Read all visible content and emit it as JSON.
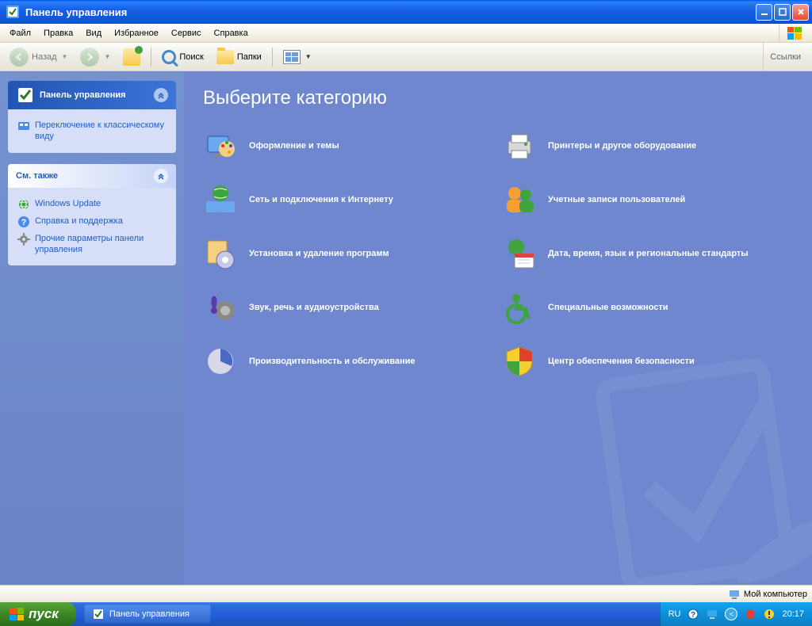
{
  "window": {
    "title": "Панель управления"
  },
  "menu": {
    "file": "Файл",
    "edit": "Правка",
    "view": "Вид",
    "favorites": "Избранное",
    "tools": "Сервис",
    "help": "Справка"
  },
  "toolbar": {
    "back": "Назад",
    "search": "Поиск",
    "folders": "Папки",
    "links": "Ссылки"
  },
  "sidebar": {
    "panel1": {
      "title": "Панель управления",
      "switch_view": "Переключение к классическому виду"
    },
    "panel2": {
      "title": "См. также",
      "items": [
        "Windows Update",
        "Справка и поддержка",
        "Прочие параметры панели управления"
      ]
    }
  },
  "content": {
    "heading": "Выберите категорию",
    "categories": [
      {
        "label": "Оформление и темы"
      },
      {
        "label": "Принтеры и другое оборудование"
      },
      {
        "label": "Сеть и подключения к Интернету"
      },
      {
        "label": "Учетные записи пользователей"
      },
      {
        "label": "Установка и удаление программ"
      },
      {
        "label": "Дата, время, язык и региональные стандарты"
      },
      {
        "label": "Звук, речь и аудиоустройства"
      },
      {
        "label": "Специальные возможности"
      },
      {
        "label": "Производительность и обслуживание"
      },
      {
        "label": "Центр обеспечения безопасности"
      }
    ]
  },
  "statusbar": {
    "location": "Мой компьютер"
  },
  "taskbar": {
    "start": "пуск",
    "active_window": "Панель управления",
    "lang": "RU",
    "clock": "20:17"
  }
}
